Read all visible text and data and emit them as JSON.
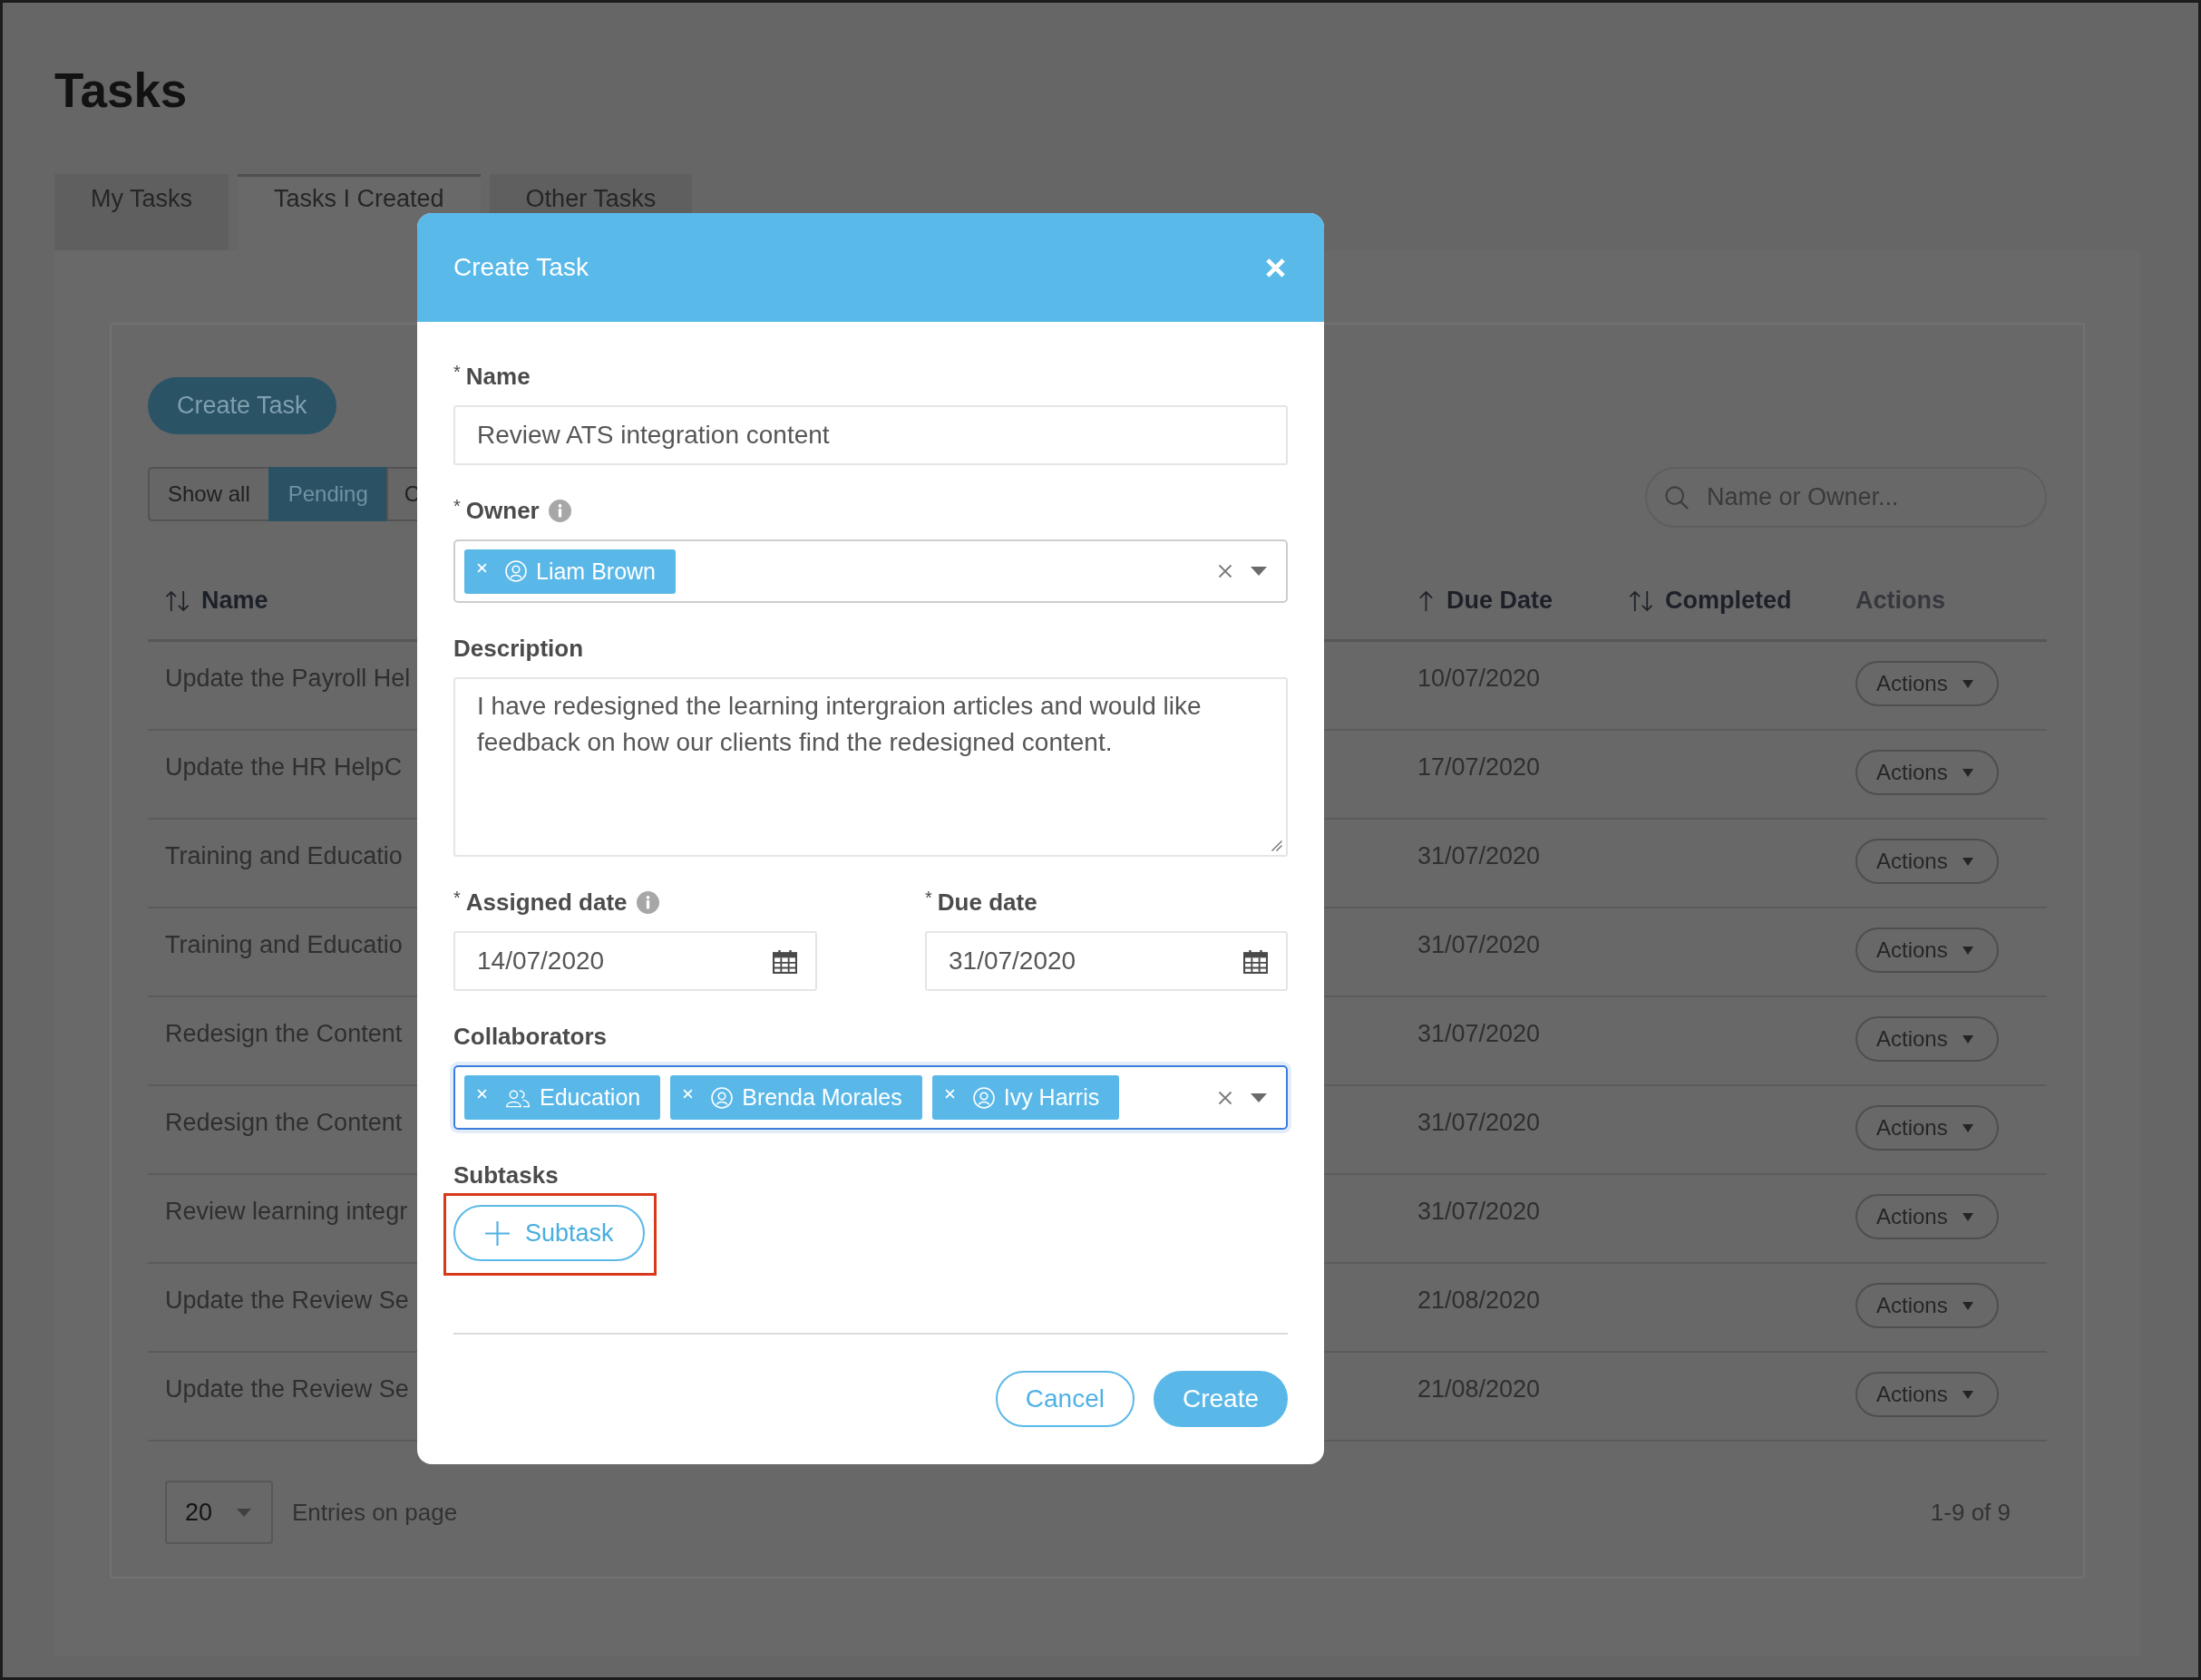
{
  "page": {
    "title": "Tasks"
  },
  "tabs": [
    {
      "label": "My Tasks",
      "selected": false
    },
    {
      "label": "Tasks I Created",
      "selected": true
    },
    {
      "label": "Other Tasks",
      "selected": false
    }
  ],
  "toolbar": {
    "create_button": "Create Task",
    "filters": [
      {
        "label": "Show all",
        "selected": false
      },
      {
        "label": "Pending",
        "selected": true
      },
      {
        "label": "C",
        "selected": false
      }
    ],
    "search": {
      "placeholder": "Name or Owner..."
    }
  },
  "table": {
    "columns": [
      {
        "label": "Name",
        "kind": "sortable"
      },
      {
        "label": "Due Date",
        "kind": "ascending"
      },
      {
        "label": "Completed",
        "kind": "sortable"
      },
      {
        "label": "Actions",
        "kind": "plain"
      }
    ],
    "rows": [
      {
        "name": "Update the Payroll Hel",
        "due_date": "10/07/2020",
        "actions": "Actions"
      },
      {
        "name": "Update the HR HelpC",
        "due_date": "17/07/2020",
        "actions": "Actions"
      },
      {
        "name": "Training and Educatio",
        "due_date": "31/07/2020",
        "actions": "Actions"
      },
      {
        "name": "Training and Educatio",
        "due_date": "31/07/2020",
        "actions": "Actions"
      },
      {
        "name": "Redesign the Content",
        "due_date": "31/07/2020",
        "actions": "Actions"
      },
      {
        "name": "Redesign the Content",
        "due_date": "31/07/2020",
        "actions": "Actions"
      },
      {
        "name": "Review learning integr",
        "due_date": "31/07/2020",
        "actions": "Actions"
      },
      {
        "name": "Update the Review Se",
        "due_date": "21/08/2020",
        "actions": "Actions"
      },
      {
        "name": "Update the Review Se",
        "due_date": "21/08/2020",
        "actions": "Actions"
      }
    ]
  },
  "pagination": {
    "page_size": "20",
    "page_size_label": "Entries on page",
    "range": "1-9 of 9"
  },
  "modal": {
    "title": "Create Task",
    "name_field": {
      "required_mark": "*",
      "label": "Name",
      "value": "Review ATS integration content"
    },
    "owner_field": {
      "required_mark": "*",
      "label": "Owner",
      "info": true,
      "focused": false,
      "tags": [
        {
          "label": "Liam Brown",
          "kind": "person"
        }
      ]
    },
    "description_field": {
      "label": "Description",
      "value": "I have redesigned the learning intergraion articles and would like feedback on how our clients find the redesigned content."
    },
    "dates": [
      {
        "required_mark": "*",
        "label": "Assigned date",
        "info": true,
        "value": "14/07/2020"
      },
      {
        "required_mark": "*",
        "label": "Due date",
        "info": false,
        "value": "31/07/2020"
      }
    ],
    "collaborators_field": {
      "label": "Collaborators",
      "focused": true,
      "tags": [
        {
          "label": "Education",
          "kind": "group"
        },
        {
          "label": "Brenda Morales",
          "kind": "person"
        },
        {
          "label": "Ivy Harris",
          "kind": "person"
        }
      ]
    },
    "subtasks": {
      "label": "Subtasks",
      "add_button": "Subtask",
      "highlighted": true
    },
    "buttons": [
      {
        "label": "Cancel",
        "kind": "secondary"
      },
      {
        "label": "Create",
        "kind": "primary"
      }
    ]
  }
}
